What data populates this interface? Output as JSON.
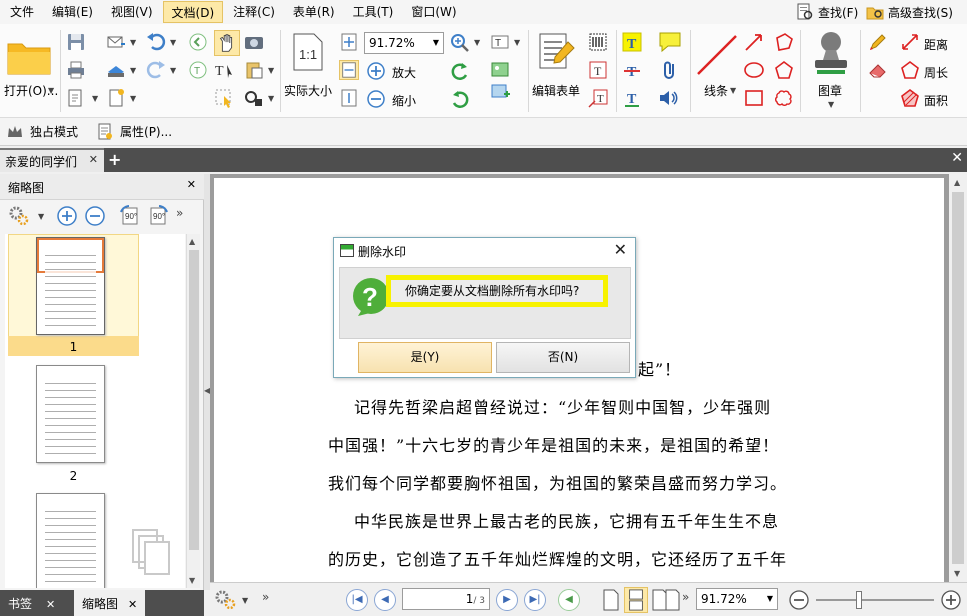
{
  "menu": {
    "items": [
      "文件",
      "编辑(E)",
      "视图(V)",
      "文档(D)",
      "注释(C)",
      "表单(R)",
      "工具(T)",
      "窗口(W)"
    ],
    "active_index": 3,
    "search_label": "查找(F)",
    "advanced_search_label": "高级查找(S)"
  },
  "ribbon": {
    "open_label": "打开(O)...",
    "zoom_value": "91.72%",
    "zoom_in_label": "放大",
    "zoom_out_label": "缩小",
    "actual_size_label": "实际大小",
    "edit_form_label": "编辑表单",
    "line_label": "线条",
    "stamp_label": "图章",
    "distance_label": "距离",
    "perimeter_label": "周长",
    "area_label": "面积"
  },
  "toolbar2": {
    "exclusive_mode_label": "独占模式",
    "properties_label": "属性(P)..."
  },
  "tabs": {
    "document_tab": "亲爱的同学们"
  },
  "left_panel": {
    "title": "缩略图",
    "thumbnails": [
      {
        "page": "1",
        "selected": true
      },
      {
        "page": "2",
        "selected": false
      }
    ]
  },
  "bottom_tabs": {
    "bookmarks": "书签",
    "thumbnails": "缩略图"
  },
  "document": {
    "lines": [
      "起”！",
      "记得先哲梁启超曾经说过：“少年智则中国智，少年强则",
      "中国强！”十六七岁的青少年是祖国的未来，是祖国的希望！",
      "我们每个同学都要胸怀祖国，为祖国的繁荣昌盛而努力学习。",
      "中华民族是世界上最古老的民族，它拥有五千年生生不息",
      "的历史，它创造了五千年灿烂辉煌的文明，它还经历了五千年"
    ]
  },
  "statusbar": {
    "current_page": "1",
    "total_pages": "/ 3",
    "zoom_value": "91.72%"
  },
  "dialog": {
    "title": "删除水印",
    "message": "你确定要从文档删除所有水印吗?",
    "yes_label": "是(Y)",
    "no_label": "否(N)"
  }
}
